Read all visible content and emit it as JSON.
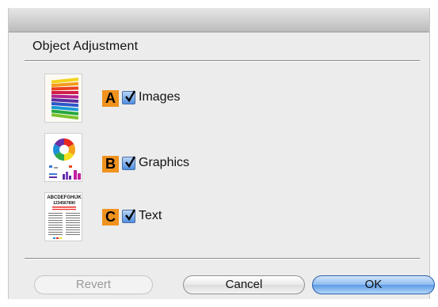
{
  "dialog": {
    "section_title": "Object Adjustment",
    "options": [
      {
        "letter": "A",
        "label": "Images",
        "checked": true,
        "thumbnail_icon": "color-pencils-image-icon"
      },
      {
        "letter": "B",
        "label": "Graphics",
        "checked": true,
        "thumbnail_icon": "color-wheel-chart-icon"
      },
      {
        "letter": "C",
        "label": "Text",
        "checked": true,
        "thumbnail_icon": "text-document-icon"
      }
    ],
    "thumb_text": {
      "line1": "ABCDEFGHIJK",
      "line2": "1234567890"
    },
    "buttons": {
      "revert": "Revert",
      "cancel": "Cancel",
      "ok": "OK"
    },
    "colors": {
      "badge": "#f0921e",
      "checkbox": "#4f8fe0",
      "default_button": "#5c9ae6"
    }
  }
}
